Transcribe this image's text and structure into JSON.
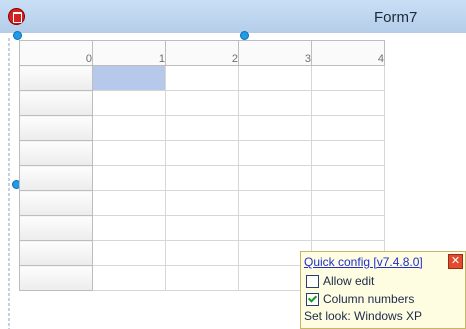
{
  "window": {
    "title": "Form7"
  },
  "grid": {
    "columns": [
      "0",
      "1",
      "2",
      "3",
      "4"
    ],
    "row_count": 9,
    "selected_cell": {
      "row": 1,
      "col": 1
    }
  },
  "quick_config": {
    "title": "Quick config [v7.4.8.0]",
    "options": [
      {
        "label": "Allow edit",
        "checked": false
      },
      {
        "label": "Column numbers",
        "checked": true
      }
    ],
    "set_look": "Set look: Windows XP"
  },
  "colors": {
    "titlebar": "#c9dff6",
    "selected_cell": "#b7c9ea",
    "panel_bg": "#fffde1"
  }
}
